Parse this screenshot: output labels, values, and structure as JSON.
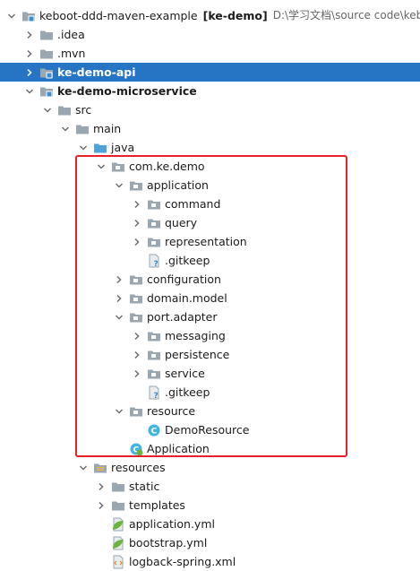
{
  "tree": [
    {
      "label": "keboot-ddd-maven-example",
      "badge": "[ke-demo]",
      "extra": "D:\\学习文档\\source code\\keboo",
      "icon": "module-icon",
      "arrow": "down",
      "level": 0,
      "bold": false
    },
    {
      "label": ".idea",
      "icon": "folder-icon",
      "arrow": "right",
      "level": 1
    },
    {
      "label": ".mvn",
      "icon": "folder-icon",
      "arrow": "right",
      "level": 1
    },
    {
      "label": "ke-demo-api",
      "icon": "module-icon",
      "arrow": "right",
      "level": 1,
      "bold": true,
      "selected": true
    },
    {
      "label": "ke-demo-microservice",
      "icon": "module-icon",
      "arrow": "down",
      "level": 1,
      "bold": true
    },
    {
      "label": "src",
      "icon": "folder-icon",
      "arrow": "down",
      "level": 2
    },
    {
      "label": "main",
      "icon": "folder-icon",
      "arrow": "down",
      "level": 3
    },
    {
      "label": "java",
      "icon": "source-folder-icon",
      "arrow": "down",
      "level": 4
    },
    {
      "label": "com.ke.demo",
      "icon": "package-icon",
      "arrow": "down",
      "level": 5
    },
    {
      "label": "application",
      "icon": "package-icon",
      "arrow": "down",
      "level": 6
    },
    {
      "label": "command",
      "icon": "package-icon",
      "arrow": "right",
      "level": 7
    },
    {
      "label": "query",
      "icon": "package-icon",
      "arrow": "right",
      "level": 7
    },
    {
      "label": "representation",
      "icon": "package-icon",
      "arrow": "right",
      "level": 7
    },
    {
      "label": ".gitkeep",
      "icon": "unknown-file-icon",
      "arrow": "none",
      "level": 7
    },
    {
      "label": "configuration",
      "icon": "package-icon",
      "arrow": "right",
      "level": 6
    },
    {
      "label": "domain.model",
      "icon": "package-icon",
      "arrow": "right",
      "level": 6
    },
    {
      "label": "port.adapter",
      "icon": "package-icon",
      "arrow": "down",
      "level": 6
    },
    {
      "label": "messaging",
      "icon": "package-icon",
      "arrow": "right",
      "level": 7
    },
    {
      "label": "persistence",
      "icon": "package-icon",
      "arrow": "right",
      "level": 7
    },
    {
      "label": "service",
      "icon": "package-icon",
      "arrow": "right",
      "level": 7
    },
    {
      "label": ".gitkeep",
      "icon": "unknown-file-icon",
      "arrow": "none",
      "level": 7
    },
    {
      "label": "resource",
      "icon": "package-icon",
      "arrow": "down",
      "level": 6
    },
    {
      "label": "DemoResource",
      "icon": "class-icon",
      "arrow": "none",
      "level": 7
    },
    {
      "label": "Application",
      "icon": "spring-app-icon",
      "arrow": "none",
      "level": 6
    },
    {
      "label": "resources",
      "icon": "resources-folder-icon",
      "arrow": "down",
      "level": 4
    },
    {
      "label": "static",
      "icon": "folder-icon",
      "arrow": "right",
      "level": 5
    },
    {
      "label": "templates",
      "icon": "folder-icon",
      "arrow": "right",
      "level": 5
    },
    {
      "label": "application.yml",
      "icon": "yaml-spring-icon",
      "arrow": "none",
      "level": 5
    },
    {
      "label": "bootstrap.yml",
      "icon": "yaml-spring-icon",
      "arrow": "none",
      "level": 5
    },
    {
      "label": "logback-spring.xml",
      "icon": "xml-file-icon",
      "arrow": "none",
      "level": 5
    }
  ],
  "colors": {
    "selection": "#2575c4",
    "highlight_border": "#e8202a",
    "folder": "#9aa7b0",
    "source_folder": "#4fa3d8",
    "class": "#40b6e0"
  }
}
